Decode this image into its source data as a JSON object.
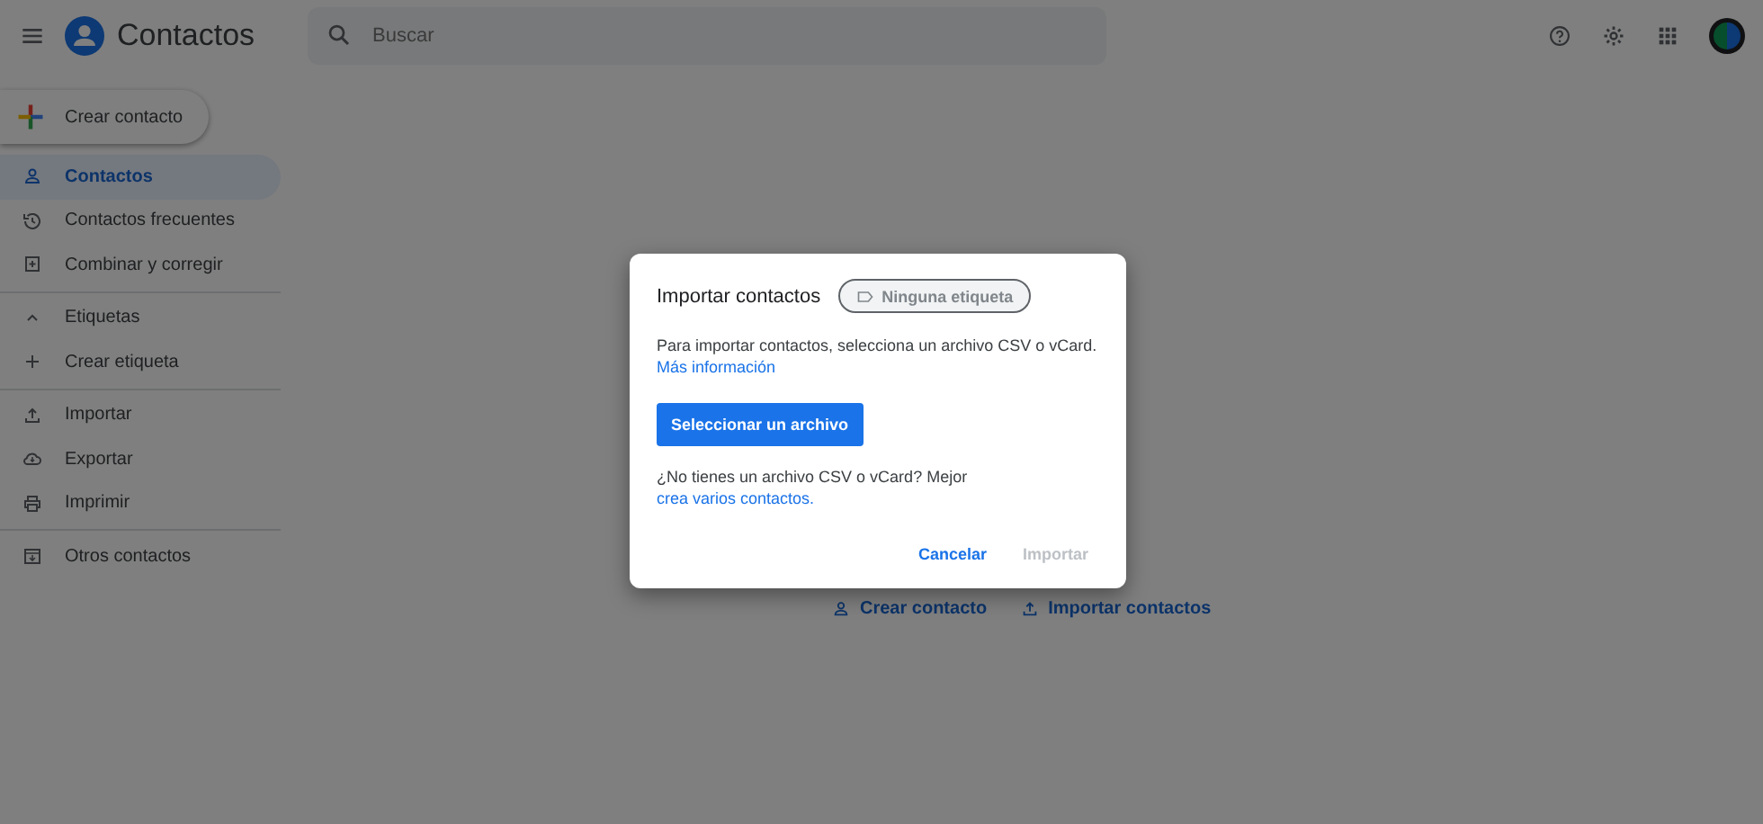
{
  "header": {
    "app_title": "Contactos",
    "search": {
      "placeholder": "Buscar"
    }
  },
  "create_button": {
    "label": "Crear contacto"
  },
  "sidebar": {
    "groups": [
      {
        "items": [
          {
            "label": "Contactos",
            "kind": "person",
            "selected": true
          },
          {
            "label": "Contactos frecuentes",
            "kind": "history",
            "selected": false
          },
          {
            "label": "Combinar y corregir",
            "kind": "merge",
            "selected": false
          }
        ]
      },
      {
        "items": [
          {
            "label": "Etiquetas",
            "kind": "chevron",
            "expanded": true,
            "selected": false
          },
          {
            "label": "Crear etiqueta",
            "kind": "plus",
            "selected": false
          }
        ]
      },
      {
        "items": [
          {
            "label": "Importar",
            "kind": "upload",
            "selected": false
          },
          {
            "label": "Exportar",
            "kind": "cloud",
            "selected": false
          },
          {
            "label": "Imprimir",
            "kind": "print",
            "selected": false
          }
        ]
      },
      {
        "items": [
          {
            "label": "Otros contactos",
            "kind": "archive",
            "selected": false
          }
        ]
      }
    ]
  },
  "empty_actions": [
    {
      "label": "Crear contacto",
      "kind": "person"
    },
    {
      "label": "Importar contactos",
      "kind": "upload"
    }
  ],
  "dialog": {
    "title": "Importar contactos",
    "label_chip": "Ninguna etiqueta",
    "message": "Para importar contactos, selecciona un archivo CSV o vCard.",
    "info_link": "Más información",
    "select_button": "Seleccionar un archivo",
    "alternative_text": "¿No tienes un archivo CSV o vCard? Mejor",
    "alternative_link": "crea varios contactos.",
    "buttons": [
      {
        "label": "Cancelar",
        "disabled": false
      },
      {
        "label": "Importar",
        "disabled": true
      }
    ]
  }
}
